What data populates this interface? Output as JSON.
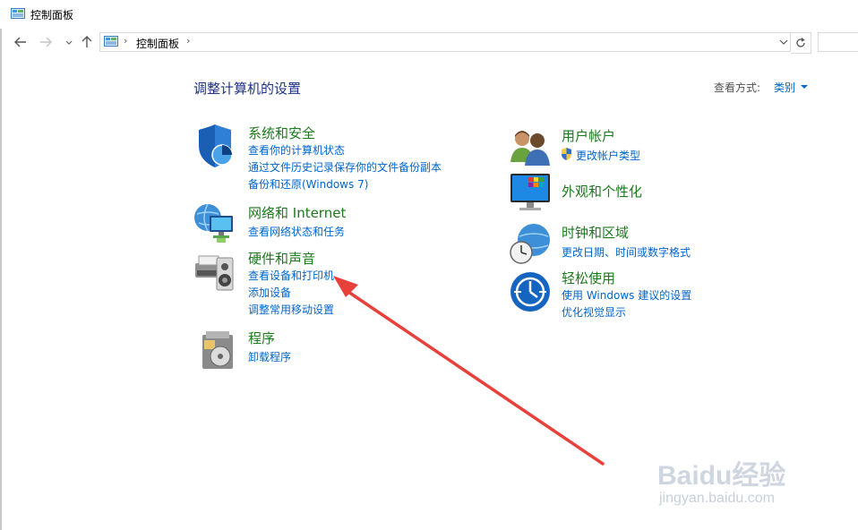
{
  "window": {
    "title": "控制面板"
  },
  "address": {
    "path": "控制面板",
    "sep": "›"
  },
  "main": {
    "heading": "调整计算机的设置",
    "view_by_label": "查看方式:",
    "view_by_value": "类别"
  },
  "categories": {
    "system": {
      "title": "系统和安全",
      "links": [
        "查看你的计算机状态",
        "通过文件历史记录保存你的文件备份副本",
        "备份和还原(Windows 7)"
      ]
    },
    "network": {
      "title": "网络和 Internet",
      "links": [
        "查看网络状态和任务"
      ]
    },
    "hardware": {
      "title": "硬件和声音",
      "links": [
        "查看设备和打印机",
        "添加设备",
        "调整常用移动设置"
      ]
    },
    "programs": {
      "title": "程序",
      "links": [
        "卸载程序"
      ]
    },
    "user": {
      "title": "用户帐户",
      "links": [
        "更改帐户类型"
      ]
    },
    "appearance": {
      "title": "外观和个性化",
      "links": []
    },
    "clock": {
      "title": "时钟和区域",
      "links": [
        "更改日期、时间或数字格式"
      ]
    },
    "ease": {
      "title": "轻松使用",
      "links": [
        "使用 Windows 建议的设置",
        "优化视觉显示"
      ]
    }
  },
  "watermark": {
    "brand": "Baidu经验",
    "url": "jingyan.baidu.com"
  },
  "colors": {
    "link": "#0066cc",
    "category": "#1b7a1b",
    "heading": "#1e3287",
    "arrow": "#e8403a"
  }
}
